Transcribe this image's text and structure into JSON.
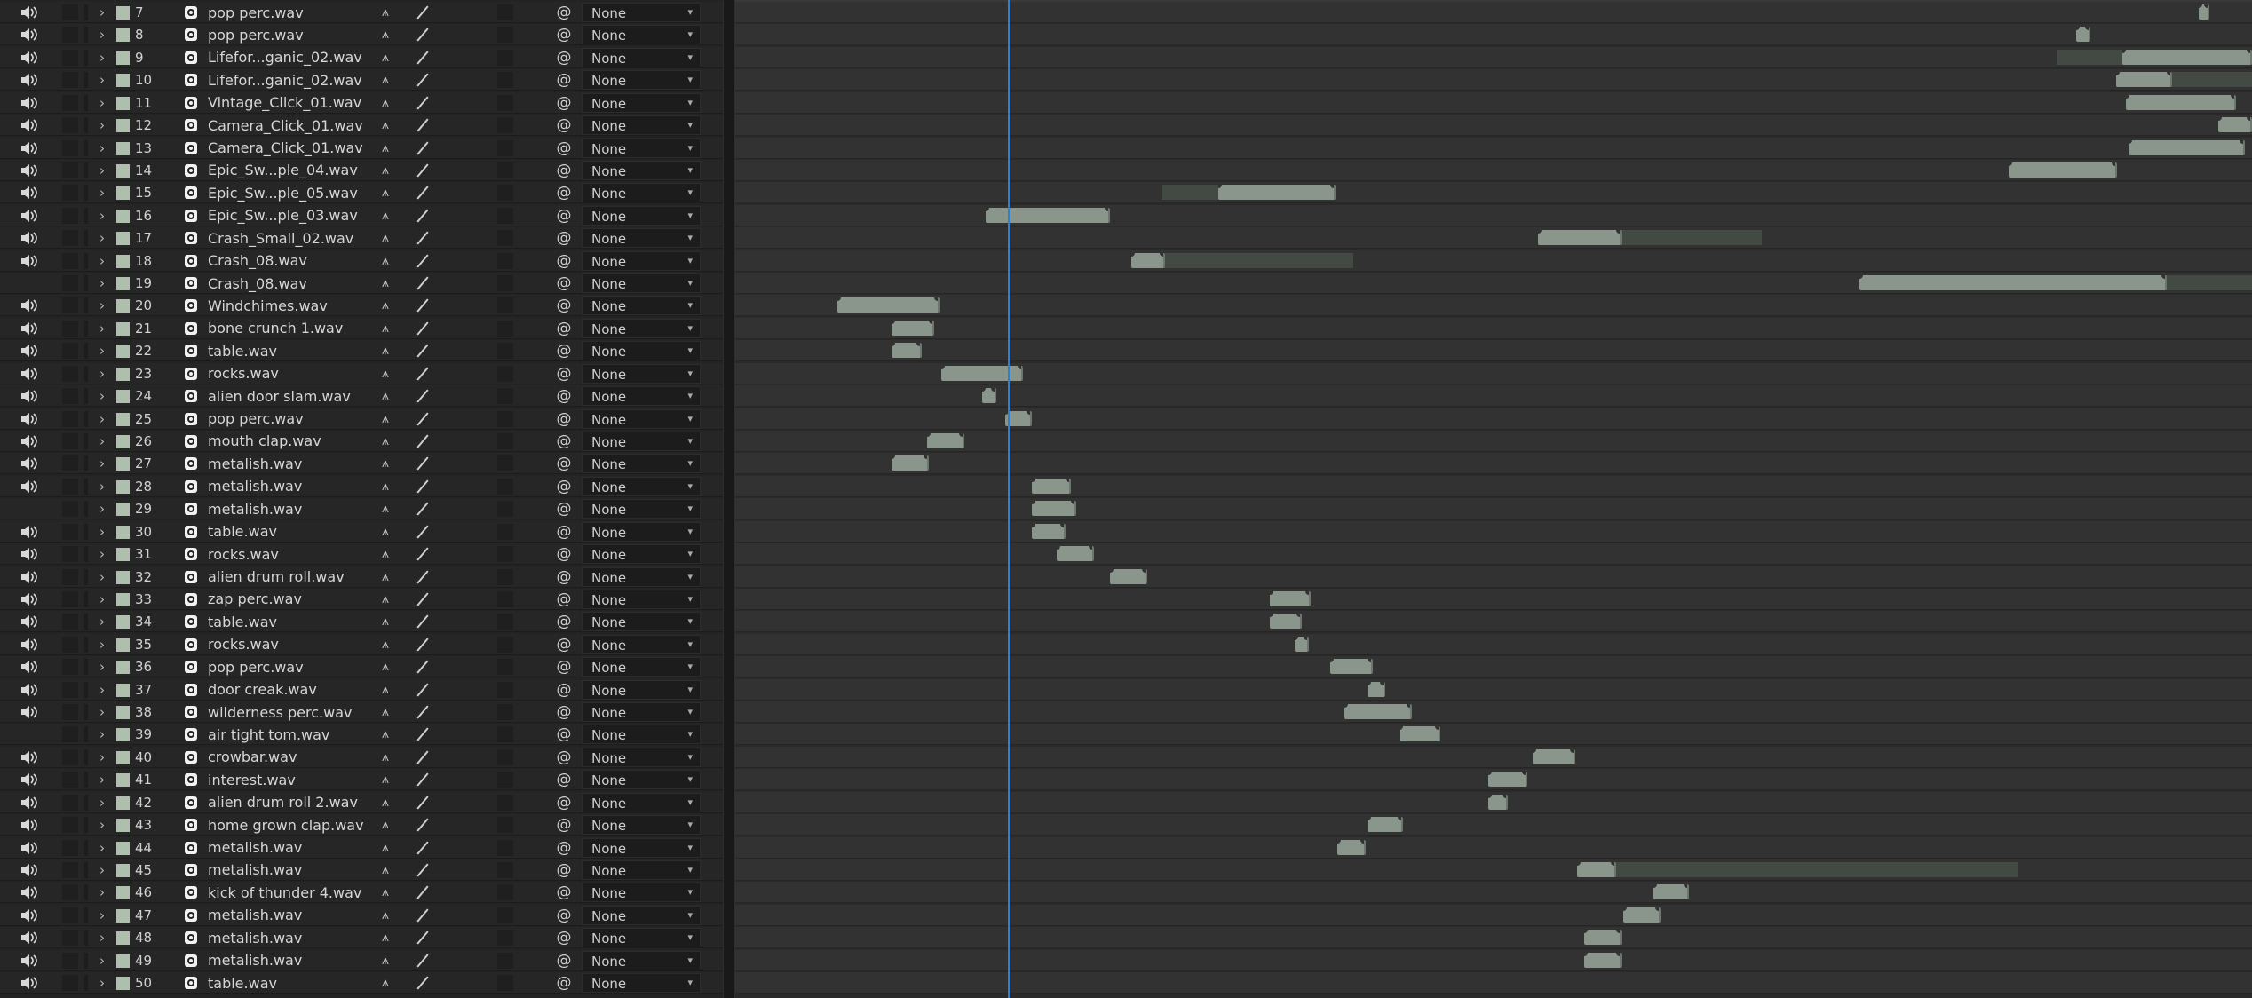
{
  "panel": "Timeline",
  "parent_default": "None",
  "icons": {
    "audio": "speaker-icon",
    "twirl": "chevron-right-icon",
    "file": "audio-file-icon",
    "shy": "shy-icon",
    "quality": "quality-slash-icon",
    "parent": "pickwhip-spiral-icon"
  },
  "colors": {
    "label": "#aebfae",
    "clip": "#8a958b",
    "playhead": "#2e7ed1"
  },
  "layers": [
    {
      "num": "7",
      "name": "pop perc.wav",
      "audio": true
    },
    {
      "num": "8",
      "name": "pop perc.wav",
      "audio": true
    },
    {
      "num": "9",
      "name": "Lifefor...ganic_02.wav",
      "audio": true
    },
    {
      "num": "10",
      "name": "Lifefor...ganic_02.wav",
      "audio": true
    },
    {
      "num": "11",
      "name": "Vintage_Click_01.wav",
      "audio": true
    },
    {
      "num": "12",
      "name": "Camera_Click_01.wav",
      "audio": true
    },
    {
      "num": "13",
      "name": "Camera_Click_01.wav",
      "audio": true
    },
    {
      "num": "14",
      "name": "Epic_Sw...ple_04.wav",
      "audio": true
    },
    {
      "num": "15",
      "name": "Epic_Sw...ple_05.wav",
      "audio": true
    },
    {
      "num": "16",
      "name": "Epic_Sw...ple_03.wav",
      "audio": true
    },
    {
      "num": "17",
      "name": "Crash_Small_02.wav",
      "audio": true
    },
    {
      "num": "18",
      "name": "Crash_08.wav",
      "audio": true
    },
    {
      "num": "19",
      "name": "Crash_08.wav",
      "audio": false
    },
    {
      "num": "20",
      "name": "Windchimes.wav",
      "audio": true
    },
    {
      "num": "21",
      "name": "bone crunch 1.wav",
      "audio": true
    },
    {
      "num": "22",
      "name": "table.wav",
      "audio": true
    },
    {
      "num": "23",
      "name": "rocks.wav",
      "audio": true
    },
    {
      "num": "24",
      "name": "alien door slam.wav",
      "audio": true
    },
    {
      "num": "25",
      "name": "pop perc.wav",
      "audio": true
    },
    {
      "num": "26",
      "name": "mouth clap.wav",
      "audio": true
    },
    {
      "num": "27",
      "name": "metalish.wav",
      "audio": true
    },
    {
      "num": "28",
      "name": "metalish.wav",
      "audio": true
    },
    {
      "num": "29",
      "name": "metalish.wav",
      "audio": false
    },
    {
      "num": "30",
      "name": "table.wav",
      "audio": true
    },
    {
      "num": "31",
      "name": "rocks.wav",
      "audio": true
    },
    {
      "num": "32",
      "name": "alien drum roll.wav",
      "audio": true
    },
    {
      "num": "33",
      "name": "zap perc.wav",
      "audio": true
    },
    {
      "num": "34",
      "name": "table.wav",
      "audio": true
    },
    {
      "num": "35",
      "name": "rocks.wav",
      "audio": true
    },
    {
      "num": "36",
      "name": "pop perc.wav",
      "audio": true
    },
    {
      "num": "37",
      "name": "door creak.wav",
      "audio": true
    },
    {
      "num": "38",
      "name": "wilderness perc.wav",
      "audio": true
    },
    {
      "num": "39",
      "name": "air tight tom.wav",
      "audio": false
    },
    {
      "num": "40",
      "name": "crowbar.wav",
      "audio": true
    },
    {
      "num": "41",
      "name": "interest.wav",
      "audio": true
    },
    {
      "num": "42",
      "name": "alien drum roll 2.wav",
      "audio": true
    },
    {
      "num": "43",
      "name": "home grown clap.wav",
      "audio": true
    },
    {
      "num": "44",
      "name": "metalish.wav",
      "audio": true
    },
    {
      "num": "45",
      "name": "metalish.wav",
      "audio": true
    },
    {
      "num": "46",
      "name": "kick of thunder 4.wav",
      "audio": true
    },
    {
      "num": "47",
      "name": "metalish.wav",
      "audio": true
    },
    {
      "num": "48",
      "name": "metalish.wav",
      "audio": true
    },
    {
      "num": "49",
      "name": "metalish.wav",
      "audio": true
    },
    {
      "num": "50",
      "name": "table.wav",
      "audio": true
    }
  ]
}
